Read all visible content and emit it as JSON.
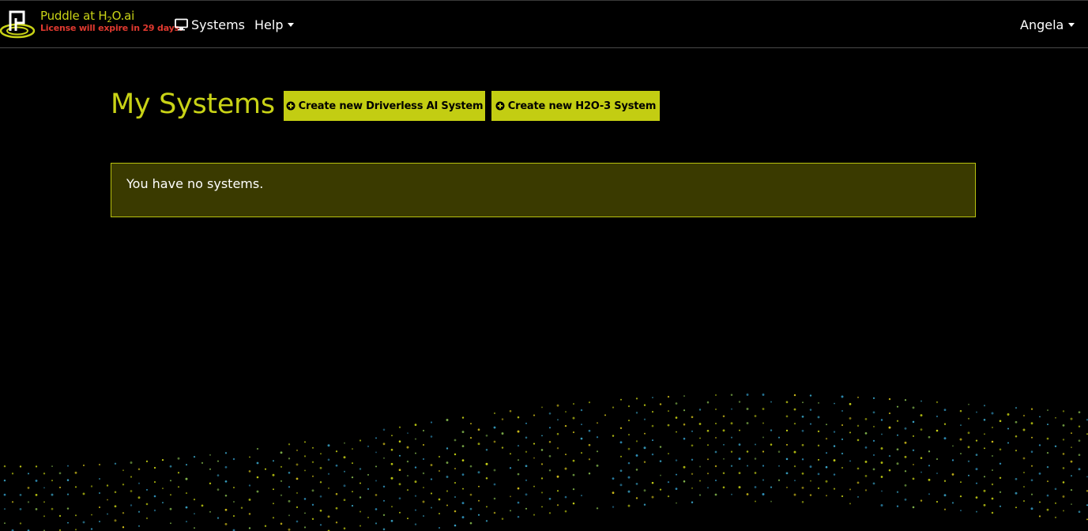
{
  "navbar": {
    "brand_name": "Puddle at H",
    "brand_sub": "2",
    "brand_suffix": "O.ai",
    "license_notice": "License will expire in 29 days.",
    "systems_label": "Systems",
    "help_label": "Help",
    "user_label": "Angela"
  },
  "main": {
    "title": "My Systems",
    "create_dai_label": "Create new Driverless AI System",
    "create_h2o3_label": "Create new H2O-3 System",
    "empty_message": "You have no systems."
  },
  "icons": {
    "logo": "puddle-logo-icon",
    "systems": "monitor-icon",
    "create": "plus-circle-icon",
    "dropdown": "caret-down-icon"
  },
  "colors": {
    "background": "#000000",
    "accent": "#c9d316",
    "button_bg": "#c3cd12",
    "license_warning": "#e0392f",
    "alert_bg": "#3a3a00",
    "alert_border": "#b9c20f"
  }
}
